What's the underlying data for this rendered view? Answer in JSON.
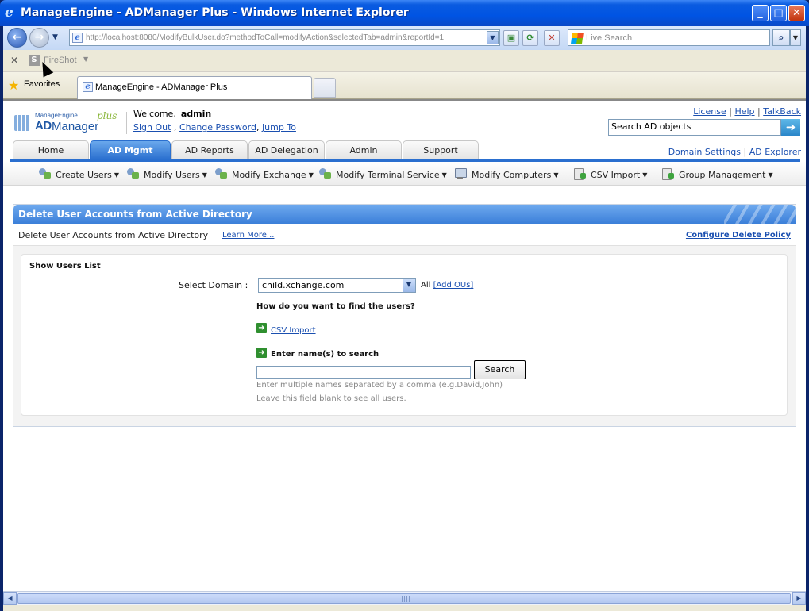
{
  "window": {
    "title": "ManageEngine - ADManager Plus - Windows Internet Explorer",
    "minimize": "_",
    "maximize": "□",
    "close": "✕"
  },
  "browser": {
    "address": "http://localhost:8080/ModifyBulkUser.do?methodToCall=modifyAction&selectedTab=admin&reportId=1",
    "live_search_placeholder": "Live Search",
    "fireshot_label": "FireShot",
    "favorites_label": "Favorites",
    "tab_title": "ManageEngine - ADManager Plus"
  },
  "header": {
    "logo": {
      "brand": "ManageEngine",
      "ad": "AD",
      "manager": "Manager",
      "plus": "plus"
    },
    "welcome_label": "Welcome,",
    "username": "admin",
    "links": {
      "sign_out": "Sign Out",
      "change_password": "Change Password",
      "jump_to": "Jump To"
    },
    "top_links": {
      "license": "License",
      "help": "Help",
      "talkback": "TalkBack"
    },
    "search_value": "Search AD objects",
    "right_links": {
      "domain_settings": "Domain Settings",
      "ad_explorer": "AD Explorer"
    }
  },
  "tabs": [
    {
      "label": "Home"
    },
    {
      "label": "AD Mgmt",
      "active": true
    },
    {
      "label": "AD Reports"
    },
    {
      "label": "AD Delegation"
    },
    {
      "label": "Admin"
    },
    {
      "label": "Support"
    }
  ],
  "submenu": [
    {
      "label": "Create Users",
      "icon": "users-icon"
    },
    {
      "label": "Modify Users",
      "icon": "users-edit-icon"
    },
    {
      "label": "Modify Exchange",
      "icon": "exchange-icon"
    },
    {
      "label": "Modify Terminal Service",
      "icon": "terminal-icon"
    },
    {
      "label": "Modify Computers",
      "icon": "computer-icon"
    },
    {
      "label": "CSV Import",
      "icon": "csv-icon"
    },
    {
      "label": "Group Management",
      "icon": "group-icon"
    }
  ],
  "panel": {
    "title": "Delete User Accounts from Active Directory",
    "description": "Delete User Accounts from Active Directory",
    "learn_more": "Learn More...",
    "configure_policy": "Configure Delete Policy",
    "show_users_list": "Show Users List",
    "select_domain_label": "Select Domain :",
    "domain_value": "child.xchange.com",
    "all_label": "All",
    "add_ous": "[Add OUs]",
    "how_question": "How do you want to find the users?",
    "csv_import": "CSV Import",
    "enter_names": "Enter name(s) to search",
    "search_button": "Search",
    "hint1": "Enter multiple names separated by a comma (e.g.David,John)",
    "hint2": "Leave this field blank to see all users."
  },
  "colors": {
    "accent": "#2a6fcf",
    "link": "#1a4fb0",
    "title_bar": "#0054e3"
  }
}
